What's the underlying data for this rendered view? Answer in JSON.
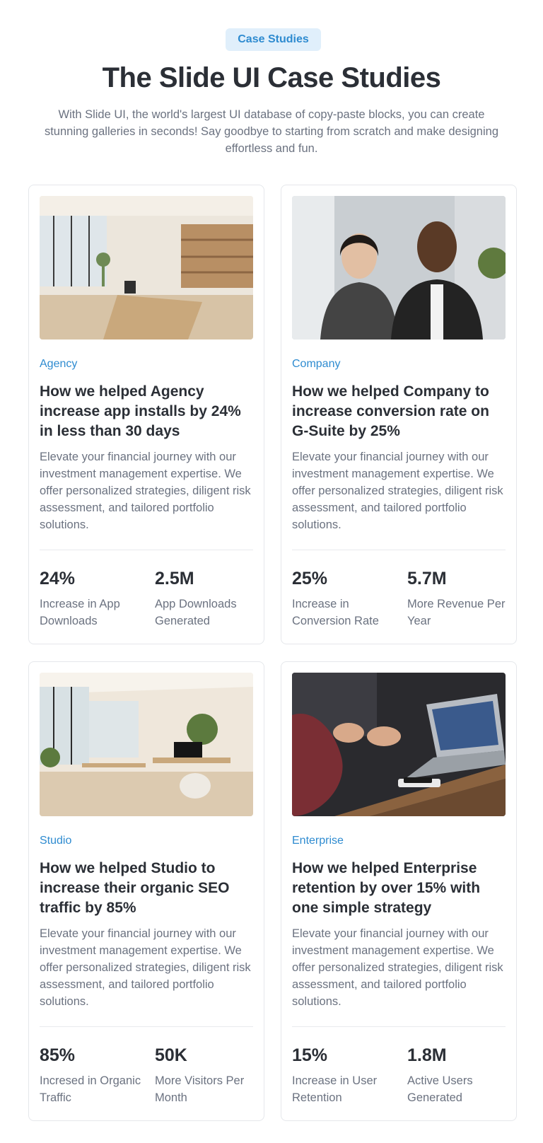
{
  "header": {
    "badge": "Case Studies",
    "title": "The Slide UI Case Studies",
    "subtitle": "With Slide UI, the world's largest UI database of copy-paste blocks, you can create stunning galleries in seconds! Say goodbye to starting from scratch and make designing effortless and fun."
  },
  "cards": [
    {
      "tag": "Agency",
      "title": "How we helped Agency increase app installs by 24% in less than 30 days",
      "description": "Elevate your financial journey with our investment management expertise. We offer personalized strategies, diligent risk assessment, and tailored portfolio solutions.",
      "stats": [
        {
          "value": "24%",
          "label": "Increase in App Downloads"
        },
        {
          "value": "2.5M",
          "label": "App Downloads Generated"
        }
      ],
      "image": "office-interior-photo"
    },
    {
      "tag": "Company",
      "title": "How we helped Company to increase conversion rate on G-Suite by 25%",
      "description": "Elevate your financial journey with our investment management expertise. We offer personalized strategies, diligent risk assessment, and tailored portfolio solutions.",
      "stats": [
        {
          "value": "25%",
          "label": "Increase in Conversion Rate"
        },
        {
          "value": "5.7M",
          "label": "More Revenue Per Year"
        }
      ],
      "image": "two-people-portrait-photo"
    },
    {
      "tag": "Studio",
      "title": "How we helped Studio to increase their organic SEO traffic by 85%",
      "description": "Elevate your financial journey with our investment management expertise. We offer personalized strategies, diligent risk assessment, and tailored portfolio solutions.",
      "stats": [
        {
          "value": "85%",
          "label": "Incresed in Organic Traffic"
        },
        {
          "value": "50K",
          "label": "More Visitors Per Month"
        }
      ],
      "image": "open-office-photo"
    },
    {
      "tag": "Enterprise",
      "title": "How we helped Enterprise retention by over 15% with one simple strategy",
      "description": "Elevate your financial journey with our investment management expertise. We offer personalized strategies, diligent risk assessment, and tailored portfolio solutions.",
      "stats": [
        {
          "value": "15%",
          "label": "Increase in User Retention"
        },
        {
          "value": "1.8M",
          "label": "Active Users Generated"
        }
      ],
      "image": "meeting-laptop-photo"
    }
  ],
  "colors": {
    "accent": "#2e8bd0",
    "badge_bg": "#e0effb",
    "heading": "#2b2f36",
    "body_text": "#6b7280",
    "border": "#e5e7eb"
  }
}
